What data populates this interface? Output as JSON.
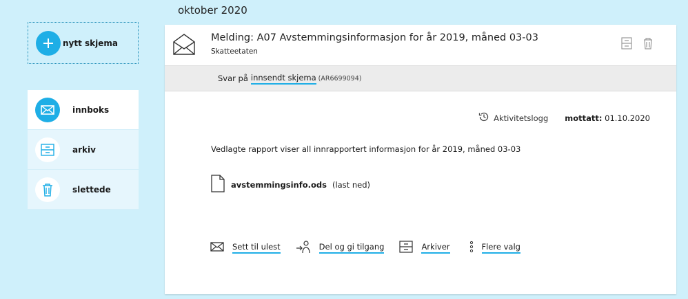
{
  "month_header": "oktober 2020",
  "new_form": {
    "label": "nytt skjema",
    "icon": "plus-icon",
    "color": "#1eaee6"
  },
  "nav": {
    "items": [
      {
        "label": "innboks",
        "icon": "envelope-icon",
        "active": true
      },
      {
        "label": "arkiv",
        "icon": "archive-icon",
        "active": false
      },
      {
        "label": "slettede",
        "icon": "trash-icon",
        "active": false
      }
    ]
  },
  "message": {
    "title": "Melding: A07 Avstemmingsinformasjon for år 2019, måned 03-03",
    "sender": "Skatteetaten",
    "reply_prefix": "Svar på",
    "reply_link": "innsendt skjema",
    "reply_code": "(AR6699094)",
    "activity_log": "Aktivitetslogg",
    "received_label": "mottatt:",
    "received_date": "01.10.2020",
    "body": "Vedlagte rapport viser all innrapportert informasjon for år 2019, måned 03-03",
    "attachment": {
      "filename": "avstemmingsinfo.ods",
      "download": "(last ned)"
    }
  },
  "actions": [
    {
      "label": "Sett til ulest",
      "icon": "envelope-icon"
    },
    {
      "label": "Del og gi tilgang",
      "icon": "share-person-icon"
    },
    {
      "label": "Arkiver",
      "icon": "archive-icon"
    },
    {
      "label": "Flere valg",
      "icon": "more-vertical-icon"
    }
  ],
  "colors": {
    "background": "#cff0fb",
    "accent": "#1eaee6",
    "reply_bar": "#ececec"
  }
}
